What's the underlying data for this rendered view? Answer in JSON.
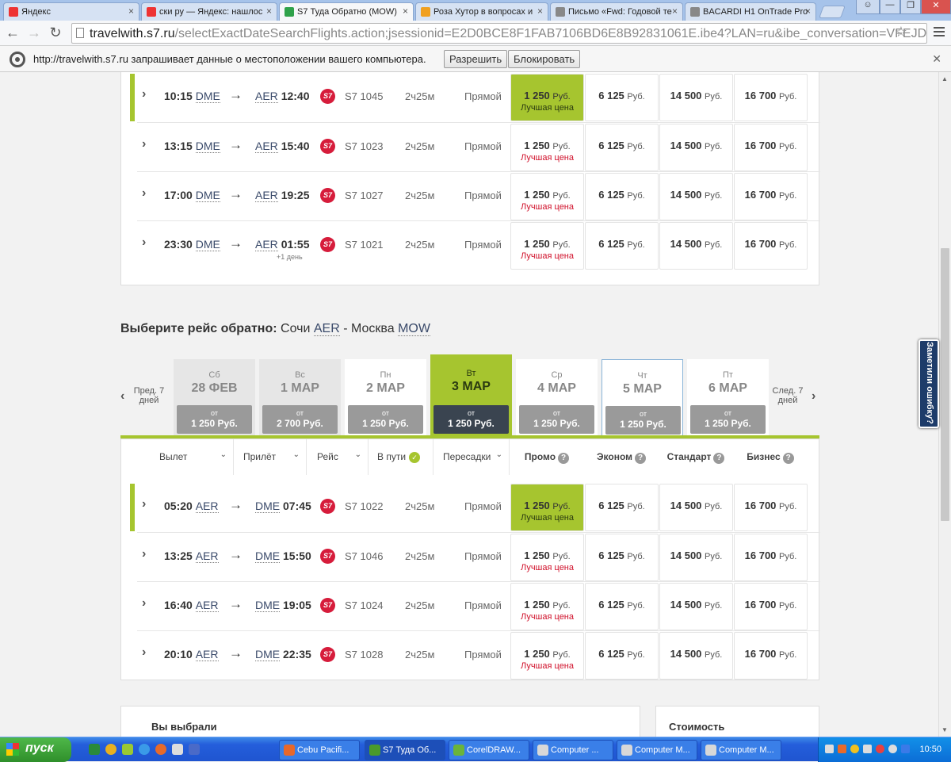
{
  "browser": {
    "tabs": [
      {
        "title": "Яндекс",
        "fav_color": "#e33"
      },
      {
        "title": "ски ру — Яндекс: нашлос",
        "fav_color": "#e33"
      },
      {
        "title": "S7 Туда Обратно (MOW)",
        "fav_color": "#2fa24a"
      },
      {
        "title": "Роза Хутор в вопросах и",
        "fav_color": "#f0a020"
      },
      {
        "title": "Письмо «Fwd: Годовой те",
        "fav_color": "#888"
      },
      {
        "title": "BACARDI H1 OnTrade Pro",
        "fav_color": "#888"
      }
    ],
    "url_host": "travelwith.s7.ru",
    "url_path": "/selectExactDateSearchFlights.action;jsessionid=E2D0BCE8F1FAB7106BD6E8B92831061E.ibe4?LAN=ru&ibe_conversation=VFEJDQ4MENM",
    "infobar": {
      "message": "http://travelwith.s7.ru запрашивает данные о местоположении вашего компьютера.",
      "allow": "Разрешить",
      "block": "Блокировать"
    }
  },
  "outbound_rows": [
    {
      "dep_time": "10:15",
      "dep_code": "DME",
      "arr_code": "AER",
      "arr_time": "12:40",
      "next_day": "",
      "flight": "S7 1045",
      "duration": "2ч25м",
      "transfers": "Прямой",
      "promo": "1 250",
      "promo_note": "Лучшая цена",
      "econ": "6 125",
      "std": "14 500",
      "biz": "16 700",
      "selected": true
    },
    {
      "dep_time": "13:15",
      "dep_code": "DME",
      "arr_code": "AER",
      "arr_time": "15:40",
      "next_day": "",
      "flight": "S7 1023",
      "duration": "2ч25м",
      "transfers": "Прямой",
      "promo": "1 250",
      "promo_note": "Лучшая цена",
      "econ": "6 125",
      "std": "14 500",
      "biz": "16 700",
      "selected": false
    },
    {
      "dep_time": "17:00",
      "dep_code": "DME",
      "arr_code": "AER",
      "arr_time": "19:25",
      "next_day": "",
      "flight": "S7 1027",
      "duration": "2ч25м",
      "transfers": "Прямой",
      "promo": "1 250",
      "promo_note": "Лучшая цена",
      "econ": "6 125",
      "std": "14 500",
      "biz": "16 700",
      "selected": false
    },
    {
      "dep_time": "23:30",
      "dep_code": "DME",
      "arr_code": "AER",
      "arr_time": "01:55",
      "next_day": "+1 день",
      "flight": "S7 1021",
      "duration": "2ч25м",
      "transfers": "Прямой",
      "promo": "1 250",
      "promo_note": "Лучшая цена",
      "econ": "6 125",
      "std": "14 500",
      "biz": "16 700",
      "selected": false
    }
  ],
  "return_heading": {
    "label": "Выберите рейс обратно:",
    "from_city": "Сочи",
    "from_code": "AER",
    "sep": " - ",
    "to_city": "Москва",
    "to_code": "MOW"
  },
  "date_nav": {
    "prev": "Пред. 7 дней",
    "next": "След. 7 дней",
    "from_label": "от",
    "days": [
      {
        "wd": "Сб",
        "date": "28 ФЕВ",
        "price": "1 250 Руб.",
        "state": "plain"
      },
      {
        "wd": "Вс",
        "date": "1 МАР",
        "price": "2 700 Руб.",
        "state": "plain"
      },
      {
        "wd": "Пн",
        "date": "2 МАР",
        "price": "1 250 Руб.",
        "state": "light"
      },
      {
        "wd": "Вт",
        "date": "3 МАР",
        "price": "1 250 Руб.",
        "state": "active"
      },
      {
        "wd": "Ср",
        "date": "4 МАР",
        "price": "1 250 Руб.",
        "state": "light"
      },
      {
        "wd": "Чт",
        "date": "5 МАР",
        "price": "1 250 Руб.",
        "state": "outlined"
      },
      {
        "wd": "Пт",
        "date": "6 МАР",
        "price": "1 250 Руб.",
        "state": "light"
      }
    ]
  },
  "columns": {
    "dep": "Вылет",
    "arr": "Прилёт",
    "flight": "Рейс",
    "enroute": "В пути",
    "transfers": "Пересадки",
    "promo": "Промо",
    "econ": "Эконом",
    "std": "Стандарт",
    "biz": "Бизнес"
  },
  "currency": "Руб.",
  "return_rows": [
    {
      "dep_time": "05:20",
      "dep_code": "AER",
      "arr_code": "DME",
      "arr_time": "07:45",
      "next_day": "",
      "flight": "S7 1022",
      "duration": "2ч25м",
      "transfers": "Прямой",
      "promo": "1 250",
      "promo_note": "Лучшая цена",
      "econ": "6 125",
      "std": "14 500",
      "biz": "16 700",
      "selected": true
    },
    {
      "dep_time": "13:25",
      "dep_code": "AER",
      "arr_code": "DME",
      "arr_time": "15:50",
      "next_day": "",
      "flight": "S7 1046",
      "duration": "2ч25м",
      "transfers": "Прямой",
      "promo": "1 250",
      "promo_note": "Лучшая цена",
      "econ": "6 125",
      "std": "14 500",
      "biz": "16 700",
      "selected": false
    },
    {
      "dep_time": "16:40",
      "dep_code": "AER",
      "arr_code": "DME",
      "arr_time": "19:05",
      "next_day": "",
      "flight": "S7 1024",
      "duration": "2ч25м",
      "transfers": "Прямой",
      "promo": "1 250",
      "promo_note": "Лучшая цена",
      "econ": "6 125",
      "std": "14 500",
      "biz": "16 700",
      "selected": false
    },
    {
      "dep_time": "20:10",
      "dep_code": "AER",
      "arr_code": "DME",
      "arr_time": "22:35",
      "next_day": "",
      "flight": "S7 1028",
      "duration": "2ч25м",
      "transfers": "Прямой",
      "promo": "1 250",
      "promo_note": "Лучшая цена",
      "econ": "6 125",
      "std": "14 500",
      "biz": "16 700",
      "selected": false
    }
  ],
  "airline_logo_text": "S7",
  "summary": {
    "chosen": "Вы выбрали",
    "cost": "Стоимость"
  },
  "feedback": "Заметили ошибку?",
  "taskbar": {
    "start": "пуск",
    "items": [
      {
        "title": "Cebu Pacifi...",
        "color": "#e8682a"
      },
      {
        "title": "S7 Туда Об...",
        "color": "#4a9a2a"
      },
      {
        "title": "CorelDRAW...",
        "color": "#6ab43a"
      },
      {
        "title": "Computer ...",
        "color": "#d8d8d8"
      },
      {
        "title": "Computer M...",
        "color": "#d8d8d8"
      },
      {
        "title": "Computer M...",
        "color": "#d8d8d8"
      }
    ],
    "clock": "10:50"
  }
}
